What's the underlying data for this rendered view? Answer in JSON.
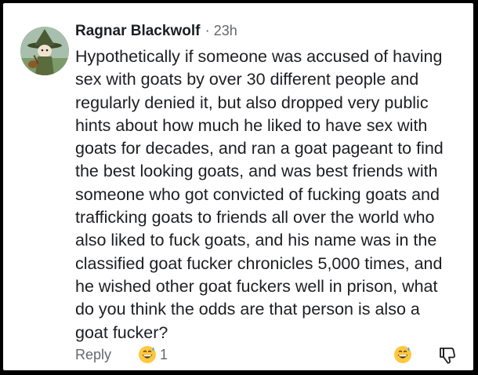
{
  "comment": {
    "author": "Ragnar Blackwolf",
    "separator": "·",
    "time": "23h",
    "lines": [
      "Hypothetically if someone was accused of having",
      "sex with goats by over 30 different people and",
      "regularly denied it, but also dropped very public",
      "hints about how much he liked to have sex with",
      "goats for decades, and ran a goat pageant to find",
      "the best looking goats, and was best friends with",
      "someone who got convicted of fucking goats and",
      "trafficking goats to friends all over the world who",
      "also liked to fuck goats, and his name was in the",
      "classified goat fucker chronicles 5,000 times, and",
      "he wished other goat fuckers well in prison, what",
      "do you think the odds are that person is also a",
      "goat fucker?"
    ]
  },
  "actions": {
    "reply_label": "Reply",
    "reaction_icon": "grinning-sweat-emoji",
    "reaction_count": "1",
    "react_icon": "grinning-sweat-emoji",
    "dislike_icon": "thumbs-down-icon"
  },
  "colors": {
    "text": "#1c1e21",
    "secondary": "#65676b",
    "emoji_yellow": "#ffc83d"
  }
}
